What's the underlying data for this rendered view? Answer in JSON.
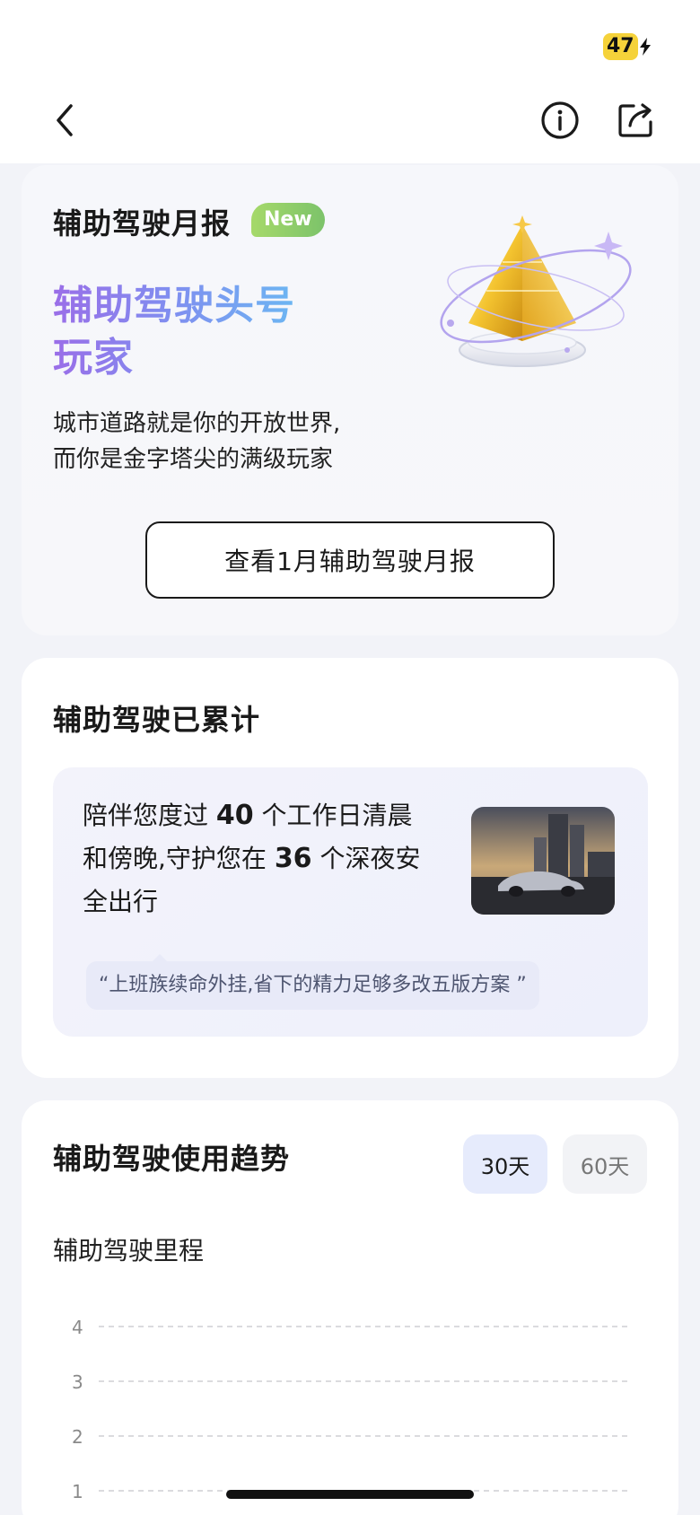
{
  "status_bar": {
    "battery_level": "47",
    "icon": "battery-charging-icon"
  },
  "nav": {
    "back_icon": "chevron-left-icon",
    "info_icon": "info-icon",
    "share_icon": "share-icon"
  },
  "monthly_report": {
    "title": "辅助驾驶月报",
    "badge": "New",
    "headline_lines": [
      "辅助驾驶头号",
      "玩家"
    ],
    "description_lines": [
      "城市道路就是你的开放世界,",
      "而你是金字塔尖的满级玩家"
    ],
    "button_label": "查看1月辅助驾驶月报",
    "illustration": "crystal-pyramid-icon"
  },
  "cumulative": {
    "title": "辅助驾驶已累计",
    "text_parts": {
      "p1": "陪伴您度过 ",
      "workdays": "40",
      "p2": " 个工作日清晨和傍晚,守护您在 ",
      "nights": "36",
      "p3": " 个深夜安全出行"
    },
    "quote": "“上班族续命外挂,省下的精力足够多改五版方案 ”",
    "image": "car-city-photo"
  },
  "usage_trend": {
    "title": "辅助驾驶使用趋势",
    "tabs": [
      {
        "label": "30天",
        "active": true
      },
      {
        "label": "60天",
        "active": false
      }
    ],
    "metric_label": "辅助驾驶里程"
  },
  "chart_data": {
    "type": "line",
    "title": "辅助驾驶里程",
    "y_ticks": [
      4,
      3,
      2,
      1
    ],
    "grid": true,
    "series": []
  },
  "colors": {
    "accent_purple": "#9a6ee8",
    "accent_blue": "#6cb6f2",
    "badge_green": "#7cc36a",
    "battery_yellow": "#f5d23a",
    "active_tab_bg": "#e6ebfc"
  }
}
